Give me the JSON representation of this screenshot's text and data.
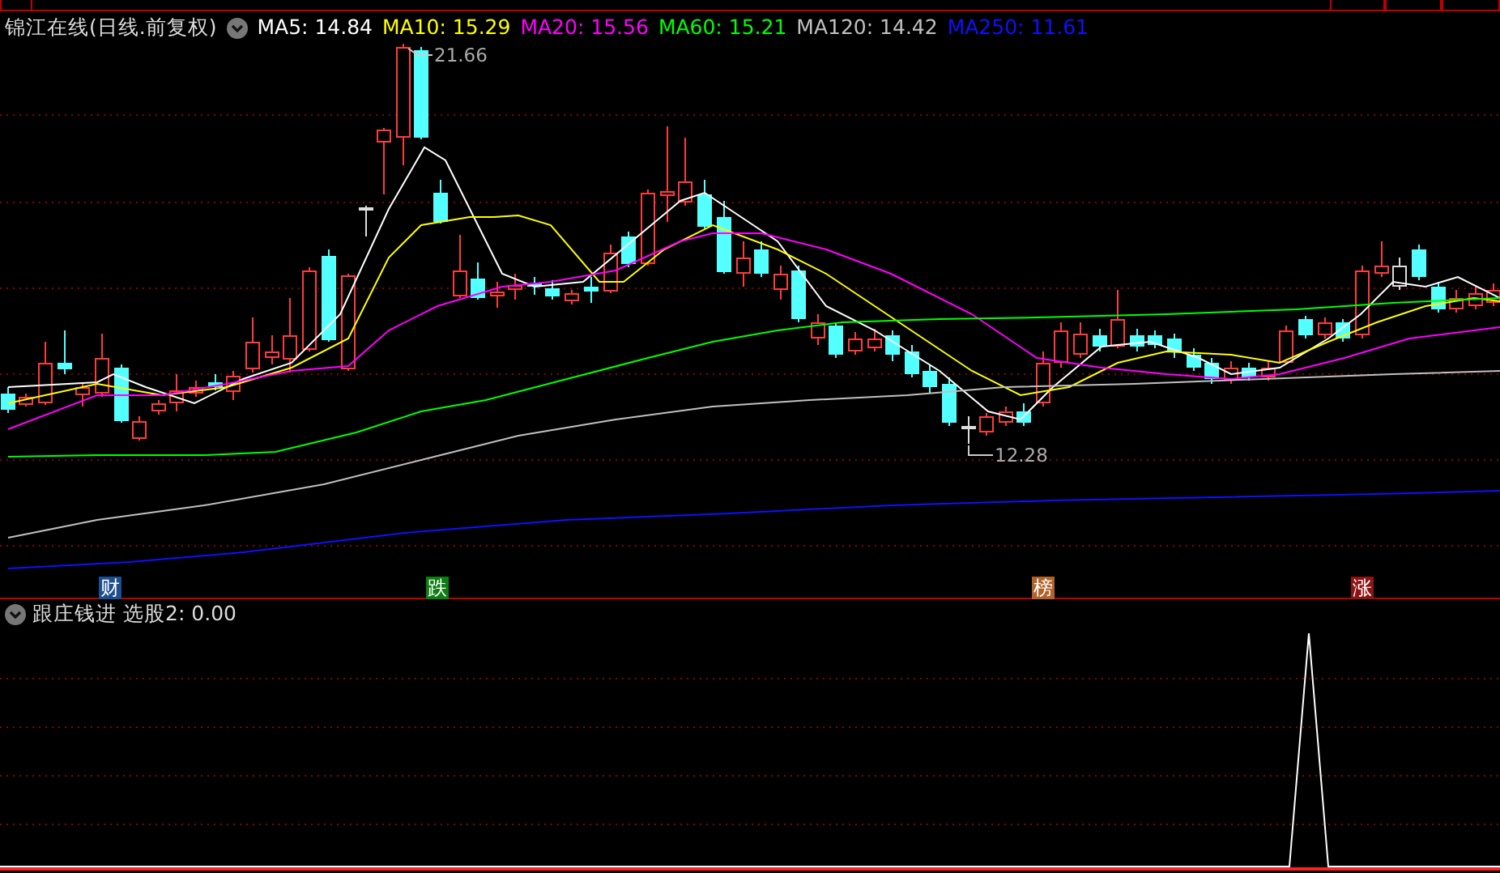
{
  "header": {
    "title": "锦江在线(日线.前复权)",
    "indicators": [
      {
        "label": "MA5: 14.84",
        "color": "#ffffff"
      },
      {
        "label": "MA10: 15.29",
        "color": "#ffff00"
      },
      {
        "label": "MA20: 15.56",
        "color": "#ff00ff"
      },
      {
        "label": "MA60: 15.21",
        "color": "#00ff00"
      },
      {
        "label": "MA120: 14.42",
        "color": "#c0c0c0"
      },
      {
        "label": "MA250: 11.61",
        "color": "#1010ff"
      }
    ]
  },
  "chart": {
    "high_label": "21.66",
    "low_label": "12.28"
  },
  "event_markers": [
    {
      "text": "财",
      "color": "#1c4f8f"
    },
    {
      "text": "跌",
      "color": "#0e7d12"
    },
    {
      "text": "榜",
      "color": "#b0622a"
    },
    {
      "text": "涨",
      "color": "#8c1414"
    }
  ],
  "lower_panel": {
    "title": "跟庄钱进",
    "reading": "选股2: 0.00"
  }
}
